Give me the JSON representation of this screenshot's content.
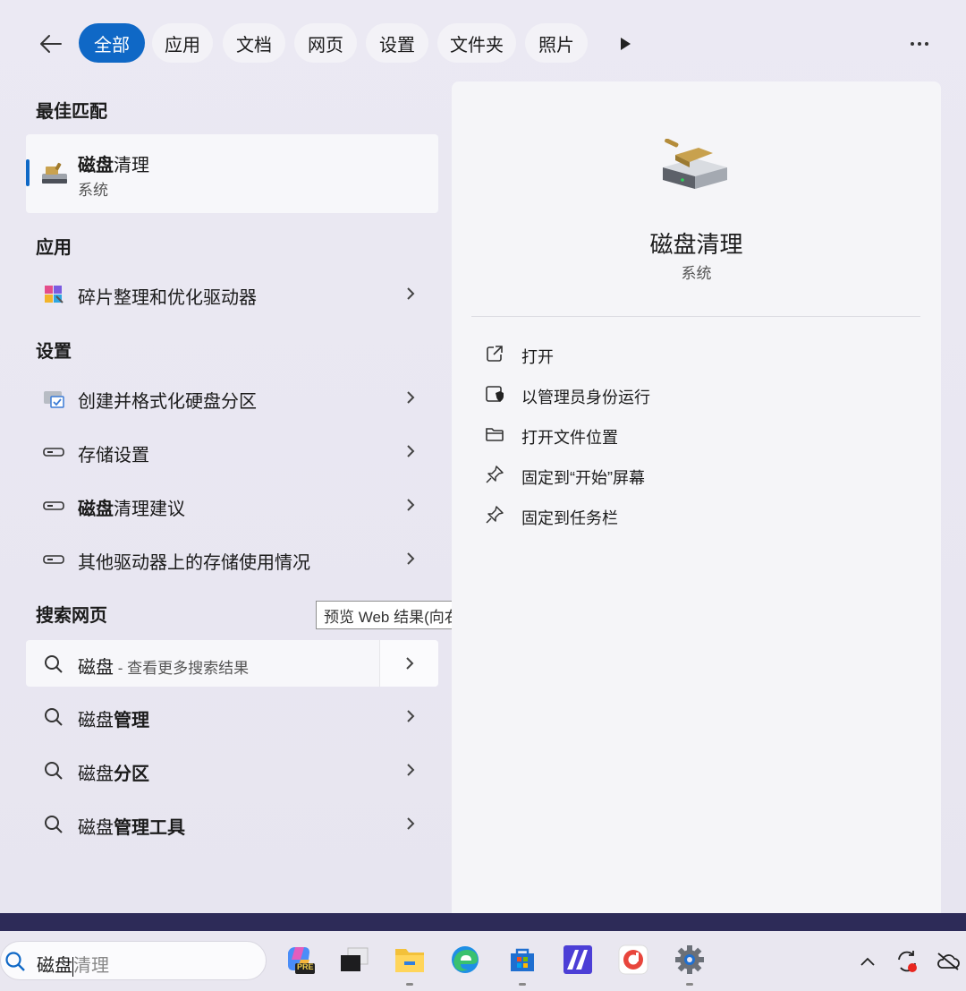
{
  "filters": {
    "back": "back",
    "tabs": [
      "全部",
      "应用",
      "文档",
      "网页",
      "设置",
      "文件夹",
      "照片"
    ],
    "active_tab": "全部"
  },
  "best_match": {
    "heading": "最佳匹配",
    "title_bold": "磁盘",
    "title_rest": "清理",
    "subtitle": "系统"
  },
  "apps": {
    "heading": "应用",
    "items": [
      {
        "label": "碎片整理和优化驱动器",
        "icon": "defrag-icon"
      }
    ]
  },
  "settings": {
    "heading": "设置",
    "items": [
      {
        "label": "创建并格式化硬盘分区",
        "icon": "disk-management-icon"
      },
      {
        "label": "存储设置",
        "icon": "drive-icon"
      },
      {
        "bold": "磁盘",
        "rest": "清理建议",
        "icon": "drive-icon"
      },
      {
        "label": "其他驱动器上的存储使用情况",
        "icon": "drive-icon"
      }
    ]
  },
  "web": {
    "heading": "搜索网页",
    "tooltip": "预览 Web 结果(向右键)",
    "first": {
      "query": "磁盘",
      "hint": " - 查看更多搜索结果"
    },
    "items": [
      {
        "normal": "磁盘",
        "bold": "管理"
      },
      {
        "normal": "磁盘",
        "bold": "分区"
      },
      {
        "normal": "磁盘",
        "bold": "管理工具"
      }
    ]
  },
  "preview": {
    "title": "磁盘清理",
    "subtitle": "系统",
    "actions": [
      {
        "label": "打开",
        "icon": "open-external-icon"
      },
      {
        "label": "以管理员身份运行",
        "icon": "shield-admin-icon"
      },
      {
        "label": "打开文件位置",
        "icon": "folder-icon"
      },
      {
        "label": "固定到“开始”屏幕",
        "icon": "pin-icon"
      },
      {
        "label": "固定到任务栏",
        "icon": "pin-icon"
      }
    ]
  },
  "taskbar": {
    "search_typed": "磁盘",
    "search_suggestion": "清理",
    "copilot_badge": "PRE",
    "apps": [
      "copilot-icon",
      "task-view-icon",
      "file-explorer-icon",
      "edge-icon",
      "store-icon",
      "app-icon",
      "red-app-icon",
      "settings-icon"
    ],
    "tray": [
      "chevron-up-icon",
      "sync-icon",
      "cloud-offline-icon"
    ]
  },
  "colors": {
    "accent": "#0f68c6",
    "panel_bg": "#ebe9f3",
    "preview_bg": "#f5f5f8",
    "taskbar_strip": "#2d2b58"
  }
}
